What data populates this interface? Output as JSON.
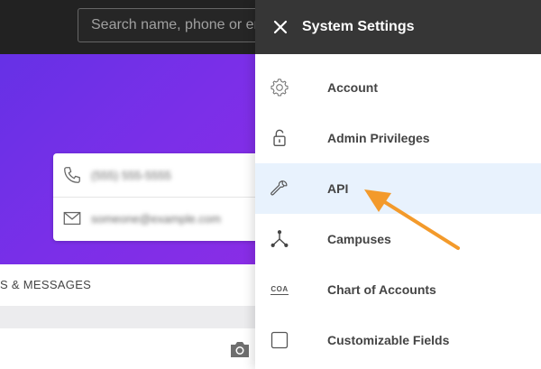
{
  "topbar": {
    "search_placeholder": "Search name, phone or email"
  },
  "contact": {
    "phone": "(555) 555-5555",
    "email": "someone@example.com"
  },
  "tabs": {
    "messages_label": "S & MESSAGES"
  },
  "drawer": {
    "title": "System Settings",
    "items": [
      {
        "label": "Account",
        "icon": "gear-icon"
      },
      {
        "label": "Admin Privileges",
        "icon": "lock-icon"
      },
      {
        "label": "API",
        "icon": "wrench-icon",
        "active": true
      },
      {
        "label": "Campuses",
        "icon": "network-icon"
      },
      {
        "label": "Chart of Accounts",
        "icon": "coa-icon",
        "icon_text": "COA"
      },
      {
        "label": "Customizable Fields",
        "icon": "checkbox-icon"
      }
    ]
  },
  "colors": {
    "banner_gradient_start": "#6631e6",
    "banner_gradient_end": "#8a2de6",
    "active_row": "#e8f2fd",
    "arrow": "#f39a2b",
    "drawer_header": "#363636"
  }
}
